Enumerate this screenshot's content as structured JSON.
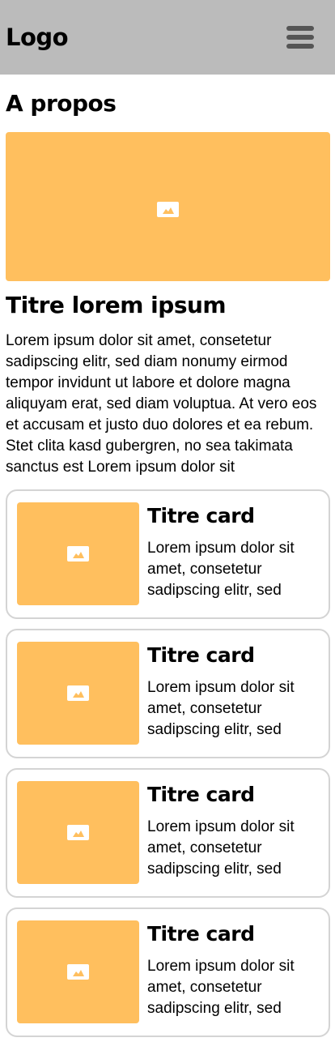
{
  "header": {
    "logo": "Logo",
    "menu_icon": "hamburger-menu-icon"
  },
  "main": {
    "title": "A propos",
    "hero_icon": "image-placeholder-icon",
    "section_title": "Titre lorem ipsum",
    "intro_text": "Lorem ipsum dolor sit amet, consetetur sadipscing elitr, sed diam nonumy eirmod tempor invidunt ut labore et dolore magna aliquyam erat, sed diam voluptua. At vero eos et accusam et justo duo dolores et ea rebum. Stet clita kasd gubergren, no sea takimata sanctus est Lorem ipsum dolor sit"
  },
  "cards": [
    {
      "title": "Titre card",
      "text": "Lorem ipsum dolor sit amet, consetetur sadipscing elitr, sed",
      "icon": "image-placeholder-icon"
    },
    {
      "title": "Titre card",
      "text": "Lorem ipsum dolor sit amet, consetetur sadipscing elitr, sed",
      "icon": "image-placeholder-icon"
    },
    {
      "title": "Titre card",
      "text": "Lorem ipsum dolor sit amet, consetetur sadipscing elitr, sed",
      "icon": "image-placeholder-icon"
    },
    {
      "title": "Titre card",
      "text": "Lorem ipsum dolor sit amet, consetetur sadipscing elitr, sed",
      "icon": "image-placeholder-icon"
    }
  ],
  "colors": {
    "header_bg": "#bbbbbb",
    "placeholder": "#ffbf5e",
    "card_border": "#d4d4d4",
    "menu_icon": "#555555"
  }
}
